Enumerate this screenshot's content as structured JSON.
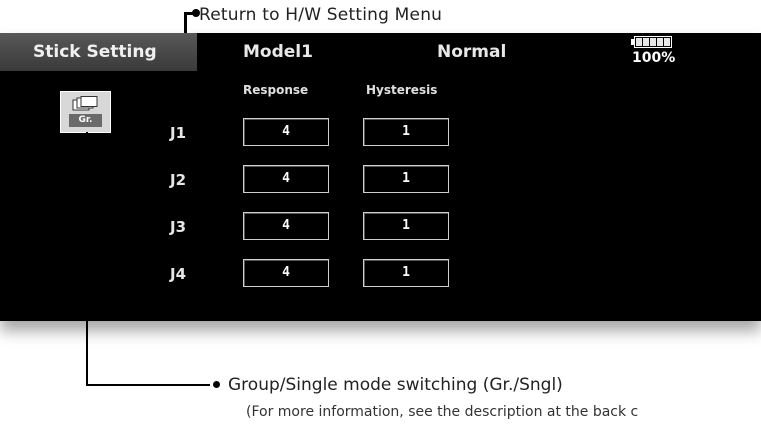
{
  "callouts": {
    "return_menu": "Return to H/W Setting Menu",
    "group_switch": "Group/Single mode switching (Gr./Sngl)",
    "group_switch_note": "(For more information, see the description at the back c"
  },
  "header": {
    "title": "Stick Setting",
    "model": "Model1",
    "condition": "Normal",
    "battery_percent": "100%"
  },
  "group_button": {
    "label": "Gr."
  },
  "columns": {
    "response": "Response",
    "hysteresis": "Hysteresis"
  },
  "rows": [
    {
      "label": "J1",
      "response": "4",
      "hysteresis": "1"
    },
    {
      "label": "J2",
      "response": "4",
      "hysteresis": "1"
    },
    {
      "label": "J3",
      "response": "4",
      "hysteresis": "1"
    },
    {
      "label": "J4",
      "response": "4",
      "hysteresis": "1"
    }
  ]
}
